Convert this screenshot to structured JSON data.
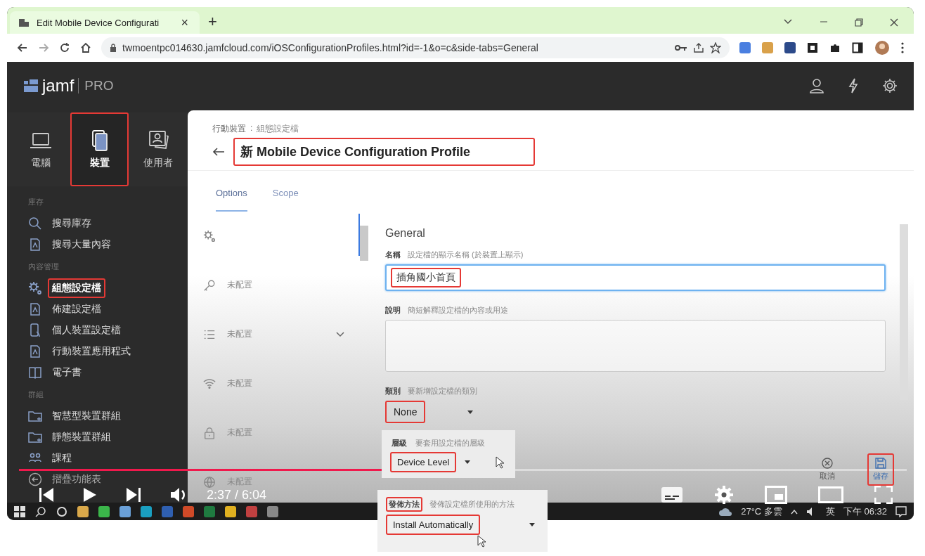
{
  "browser": {
    "tab_title": "Edit Mobile Device Configurati",
    "tab_close": "×",
    "new_tab": "+",
    "url": "twmoentpc014630.jamfcloud.com/iOSConfigurationProfiles.html?id=-1&o=c&side-tabs=General"
  },
  "app": {
    "logo": "jamf",
    "product": "PRO"
  },
  "nav_tabs": [
    {
      "label": "電腦",
      "selected": false,
      "highlighted": false
    },
    {
      "label": "裝置",
      "selected": true,
      "highlighted": true
    },
    {
      "label": "使用者",
      "selected": false,
      "highlighted": false
    }
  ],
  "sidebar": {
    "sections": [
      {
        "heading": "庫存",
        "items": [
          {
            "label": "搜尋庫存",
            "selected": false
          },
          {
            "label": "搜尋大量內容",
            "selected": false
          }
        ]
      },
      {
        "heading": "內容管理",
        "items": [
          {
            "label": "組態設定檔",
            "selected": true
          },
          {
            "label": "佈建設定檔",
            "selected": false
          },
          {
            "label": "個人裝置設定檔",
            "selected": false
          },
          {
            "label": "行動裝置應用程式",
            "selected": false
          },
          {
            "label": "電子書",
            "selected": false
          }
        ]
      },
      {
        "heading": "群組",
        "items": [
          {
            "label": "智慧型裝置群組",
            "selected": false
          },
          {
            "label": "靜態裝置群組",
            "selected": false
          },
          {
            "label": "課程",
            "selected": false
          }
        ]
      }
    ],
    "collapse": "摺疊功能表"
  },
  "breadcrumb": {
    "parent": "行動裝置",
    "separator": ":",
    "current": "組態設定檔"
  },
  "page_title": "新 Mobile Device Configuration Profile",
  "content_tabs": [
    {
      "label": "Options",
      "selected": true
    },
    {
      "label": "Scope",
      "selected": false
    }
  ],
  "payloads": [
    {
      "kind": "payload"
    },
    {
      "label": "未配置",
      "kind": "payload"
    },
    {
      "label": "未配置",
      "kind": "group"
    },
    {
      "label": "未配置",
      "kind": "payload"
    },
    {
      "label": "未配置",
      "kind": "payload"
    },
    {
      "label": "未配置",
      "kind": "payload"
    }
  ],
  "form": {
    "title": "General",
    "fields": [
      {
        "kind": "text",
        "label": "名稱",
        "hint": "設定檔的顯示名稱 (於裝置上顯示)",
        "value": "插角國小首頁",
        "focused": true,
        "highlighted": true
      },
      {
        "kind": "textarea",
        "label": "說明",
        "hint": "簡短解釋設定檔的內容或用途",
        "focused": false,
        "highlighted": false
      },
      {
        "kind": "select",
        "label": "類別",
        "hint": "要新增設定檔的類別",
        "value": "None",
        "focused": false,
        "highlighted": true
      }
    ]
  },
  "footer": {
    "cancel": "取消",
    "save": "儲存",
    "save_highlighted": true
  },
  "callouts": [
    {
      "label": "層級",
      "hint": "要套用設定檔的層級",
      "value": "Device Level",
      "label_highlighted": false,
      "value_highlighted": true
    },
    {
      "label": "發佈方法",
      "hint": "發佈設定檔所使用的方法",
      "value": "Install Automatically",
      "label_highlighted": true,
      "value_highlighted": true
    }
  ],
  "video": {
    "level": 0.43,
    "time": "2:37 / 6:04"
  },
  "taskbar": {
    "weather": "27°C 多雲",
    "language": "英",
    "clock": "下午 06:32"
  }
}
